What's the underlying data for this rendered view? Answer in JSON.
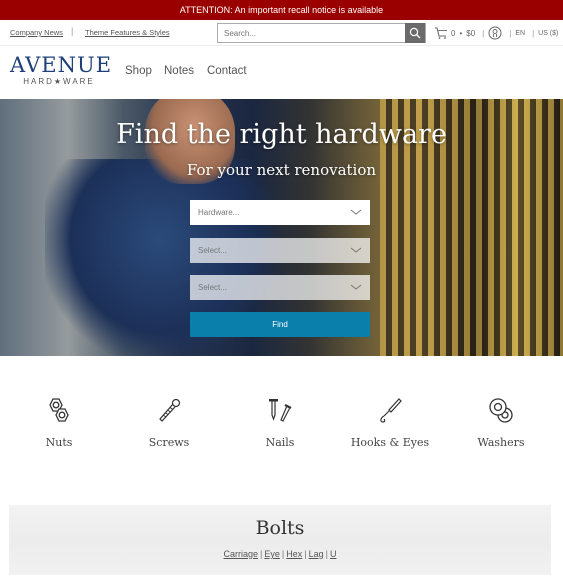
{
  "announcement": {
    "text": "ATTENTION: An important recall notice is available",
    "bg_color": "#9b0000"
  },
  "utility": {
    "links": [
      "Company News",
      "Theme Features & Styles"
    ],
    "search": {
      "placeholder": "Search...",
      "value": ""
    },
    "cart": {
      "count": "0",
      "separator": "•",
      "total": "$0"
    },
    "language": "EN",
    "currency": "US ($)"
  },
  "header": {
    "logo": {
      "top": "AVENUE",
      "bottom": "HARD★WARE",
      "color": "#1e3f7a"
    },
    "nav": [
      "Shop",
      "Notes",
      "Contact"
    ]
  },
  "hero": {
    "title": "Find the right hardware",
    "subtitle": "For your next renovation",
    "selects": [
      {
        "placeholder": "Hardware..."
      },
      {
        "placeholder": "Select..."
      },
      {
        "placeholder": "Select..."
      }
    ],
    "find_label": "Find",
    "button_color": "#0b7fab"
  },
  "categories": [
    {
      "label": "Nuts",
      "icon": "hex-nuts-icon"
    },
    {
      "label": "Screws",
      "icon": "screw-icon"
    },
    {
      "label": "Nails",
      "icon": "nails-icon"
    },
    {
      "label": "Hooks & Eyes",
      "icon": "hook-icon"
    },
    {
      "label": "Washers",
      "icon": "washers-icon"
    }
  ],
  "bolts": {
    "title": "Bolts",
    "links": [
      "Carriage",
      "Eye",
      "Hex",
      "Lag",
      "U"
    ]
  }
}
